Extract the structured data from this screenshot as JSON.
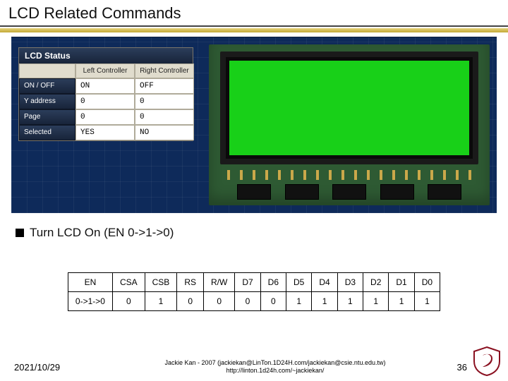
{
  "title": "LCD Related Commands",
  "panel": {
    "title": "LCD Status",
    "col_left": "Left Controller",
    "col_right": "Right Controller",
    "rows": [
      {
        "label": "ON / OFF",
        "left": "ON",
        "right": "OFF"
      },
      {
        "label": "Y address",
        "left": "0",
        "right": "0"
      },
      {
        "label": "Page",
        "left": "0",
        "right": "0"
      },
      {
        "label": "Selected",
        "left": "YES",
        "right": "NO"
      }
    ]
  },
  "bullet_text": "Turn LCD On (EN 0->1->0)",
  "cmd_table": {
    "headers": [
      "EN",
      "CSA",
      "CSB",
      "RS",
      "R/W",
      "D7",
      "D6",
      "D5",
      "D4",
      "D3",
      "D2",
      "D1",
      "D0"
    ],
    "row_label": "0->1->0",
    "values": [
      "0",
      "1",
      "0",
      "0",
      "0",
      "0",
      "1",
      "1",
      "1",
      "1",
      "1",
      "1"
    ]
  },
  "footer": {
    "date": "2021/10/29",
    "credit_line1": "Jackie Kan - 2007 (jackiekan@LinTon.1D24H.com/jackiekan@csie.ntu.edu.tw)",
    "credit_line2": "http://linton.1d24h.com/~jackiekan/",
    "page": "36"
  }
}
